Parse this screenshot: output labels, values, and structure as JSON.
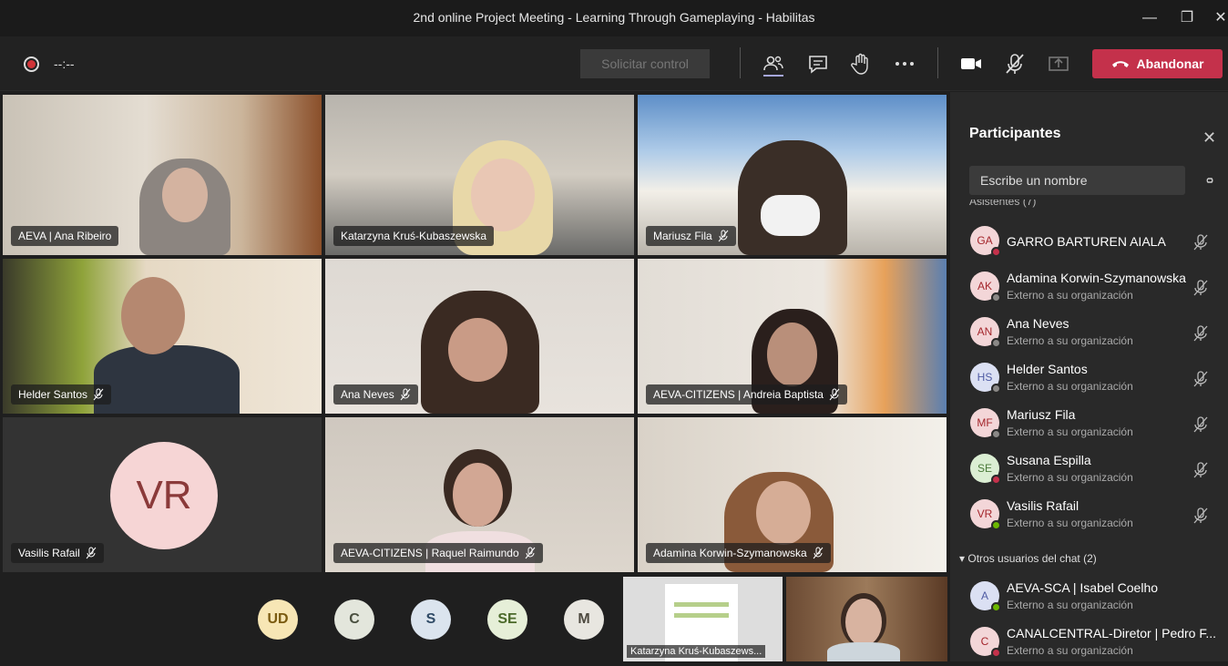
{
  "window": {
    "title": "2nd online Project Meeting - Learning Through Gameplaying - Habilitas"
  },
  "toolbar": {
    "timer": "--:--",
    "request_control": "Solicitar control",
    "leave": "Abandonar"
  },
  "tiles": [
    {
      "name": "AEVA | Ana Ribeiro",
      "muted": false
    },
    {
      "name": "Katarzyna Kruś-Kubaszewska",
      "muted": false
    },
    {
      "name": "Mariusz Fila",
      "muted": true
    },
    {
      "name": "Helder Santos",
      "muted": true
    },
    {
      "name": "Ana Neves",
      "muted": true
    },
    {
      "name": "AEVA-CITIZENS | Andreia Baptista",
      "muted": true
    },
    {
      "name": "Vasilis Rafail",
      "muted": true,
      "initials": "VR"
    },
    {
      "name": "AEVA-CITIZENS | Raquel Raimundo",
      "muted": true
    },
    {
      "name": "Adamina Korwin-Szymanowska",
      "muted": true
    }
  ],
  "bottom_avatars": [
    "UD",
    "C",
    "S",
    "SE",
    "M"
  ],
  "shared_screen_label": "Katarzyna Kruś-Kubaszews...",
  "panel": {
    "title": "Participantes",
    "search_placeholder": "Escribe un nombre",
    "participants": [
      {
        "initials": "GA",
        "name": "GARRO BARTUREN AIALA",
        "sub": "",
        "status": "busy",
        "bg": "#f3d6d8",
        "fg": "#a4262c"
      },
      {
        "initials": "AK",
        "name": "Adamina Korwin-Szymanowska",
        "sub": "Externo a su organización",
        "status": "away",
        "bg": "#f3d6d8",
        "fg": "#a4262c"
      },
      {
        "initials": "AN",
        "name": "Ana Neves",
        "sub": "Externo a su organización",
        "status": "away",
        "bg": "#f3d6d8",
        "fg": "#a4262c"
      },
      {
        "initials": "HS",
        "name": "Helder Santos",
        "sub": "Externo a su organización",
        "status": "away",
        "bg": "#dbe0f3",
        "fg": "#4f5ba4"
      },
      {
        "initials": "MF",
        "name": "Mariusz Fila",
        "sub": "Externo a su organización",
        "status": "away",
        "bg": "#f3d6d8",
        "fg": "#a4262c"
      },
      {
        "initials": "SE",
        "name": "Susana Espilla",
        "sub": "Externo a su organización",
        "status": "busy",
        "bg": "#dbeed3",
        "fg": "#4b7a3a"
      },
      {
        "initials": "VR",
        "name": "Vasilis Rafail",
        "sub": "Externo a su organización",
        "status": "available",
        "bg": "#f3d6d8",
        "fg": "#a4262c"
      }
    ],
    "other_section": "Otros usuarios del chat (2)",
    "other_users": [
      {
        "initials": "A",
        "name": "AEVA-SCA | Isabel Coelho",
        "sub": "Externo a su organización",
        "status": "available",
        "bg": "#dbe0f3",
        "fg": "#4f5ba4"
      },
      {
        "initials": "C",
        "name": "CANALCENTRAL-Diretor | Pedro F...",
        "sub": "Externo a su organización",
        "status": "busy",
        "bg": "#f3d6d8",
        "fg": "#a4262c"
      }
    ]
  },
  "colors": {
    "leave": "#c4314b",
    "busy": "#c4314b",
    "available": "#6bb700",
    "away": "#8a8886"
  }
}
